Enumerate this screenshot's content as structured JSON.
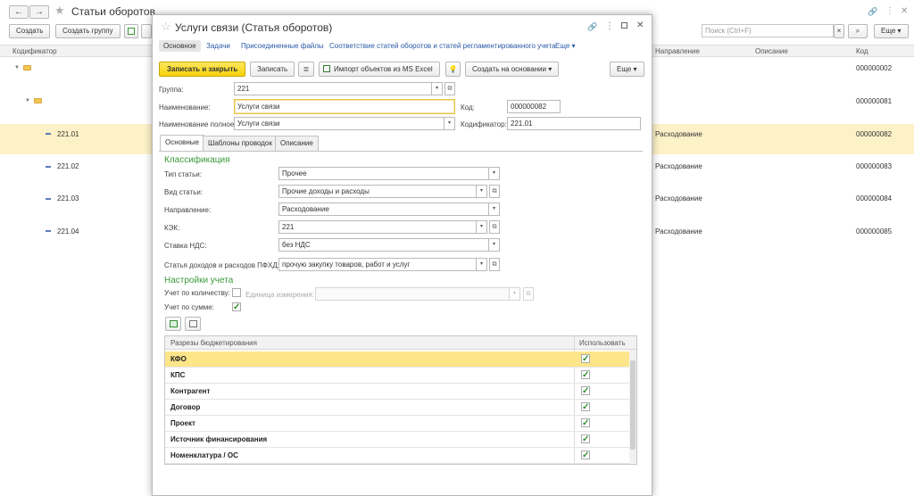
{
  "background": {
    "title": "Статьи оборотов",
    "toolbar": {
      "create_label": "Создать",
      "create_group_label": "Создать группу",
      "more_label": "Еще"
    },
    "search": {
      "placeholder": "Поиск (Ctrl+F)"
    },
    "columns": {
      "codifier": "Кодификатор",
      "direction": "Направление",
      "description": "Описание",
      "code": "Код"
    },
    "rows": [
      {
        "type": "group",
        "name": "",
        "direction": "",
        "code": "000000002"
      },
      {
        "type": "group",
        "name": "",
        "direction": "",
        "code": "000000081"
      },
      {
        "type": "item",
        "name": "221.01",
        "direction": "Расходование",
        "code": "000000082"
      },
      {
        "type": "item",
        "name": "221.02",
        "direction": "Расходование",
        "code": "000000083"
      },
      {
        "type": "item",
        "name": "221.03",
        "direction": "Расходование",
        "code": "000000084"
      },
      {
        "type": "item",
        "name": "221.04",
        "direction": "Расходование",
        "code": "000000085"
      }
    ]
  },
  "modal": {
    "title": "Услуги связи (Статья оборотов)",
    "tabs": [
      "Основное",
      "Задачи",
      "Присоединенные файлы",
      "Соответствие статей оборотов и статей регламентированного учета",
      "Еще"
    ],
    "toolbar": {
      "save_close": "Записать и закрыть",
      "save": "Записать",
      "import": "Импорт объектов из MS Excel",
      "create_based": "Создать на основании",
      "more": "Еще"
    },
    "fields": {
      "group_label": "Группа:",
      "group_value": "221",
      "name_label": "Наименование:",
      "name_value": "Услуги связи",
      "code_label": "Код:",
      "code_value": "000000082",
      "fullname_label": "Наименование полное:",
      "fullname_value": "Услуги связи",
      "codifier_label": "Кодификатор:",
      "codifier_value": "221.01"
    },
    "inner_tabs": [
      "Основные",
      "Шаблоны проводок",
      "Описание"
    ],
    "classification": {
      "title": "Классификация",
      "type_label": "Тип статьи:",
      "type_value": "Прочее",
      "kind_label": "Вид статьи:",
      "kind_value": "Прочие доходы и расходы",
      "direction_label": "Направление:",
      "direction_value": "Расходование",
      "kek_label": "КЭК:",
      "kek_value": "221",
      "vat_label": "Ставка НДС:",
      "vat_value": "без НДС",
      "pfhd_label": "Статья доходов и расходов ПФХД:",
      "pfhd_value": "прочую закупку товаров, работ и услуг"
    },
    "accounting": {
      "title": "Настройки учета",
      "by_qty_label": "Учет по количеству:",
      "by_qty_checked": false,
      "unit_label": "Единица измерения:",
      "by_sum_label": "Учет по сумме:",
      "by_sum_checked": true
    },
    "grid": {
      "col_name": "Разрезы бюджетирования",
      "col_use": "Использовать",
      "rows": [
        {
          "name": "КФО",
          "use": true
        },
        {
          "name": "КПС",
          "use": true
        },
        {
          "name": "Контрагент",
          "use": true
        },
        {
          "name": "Договор",
          "use": true
        },
        {
          "name": "Проект",
          "use": true
        },
        {
          "name": "Источник финансирования",
          "use": true
        },
        {
          "name": "Номенклатура / ОС",
          "use": true
        }
      ]
    }
  }
}
